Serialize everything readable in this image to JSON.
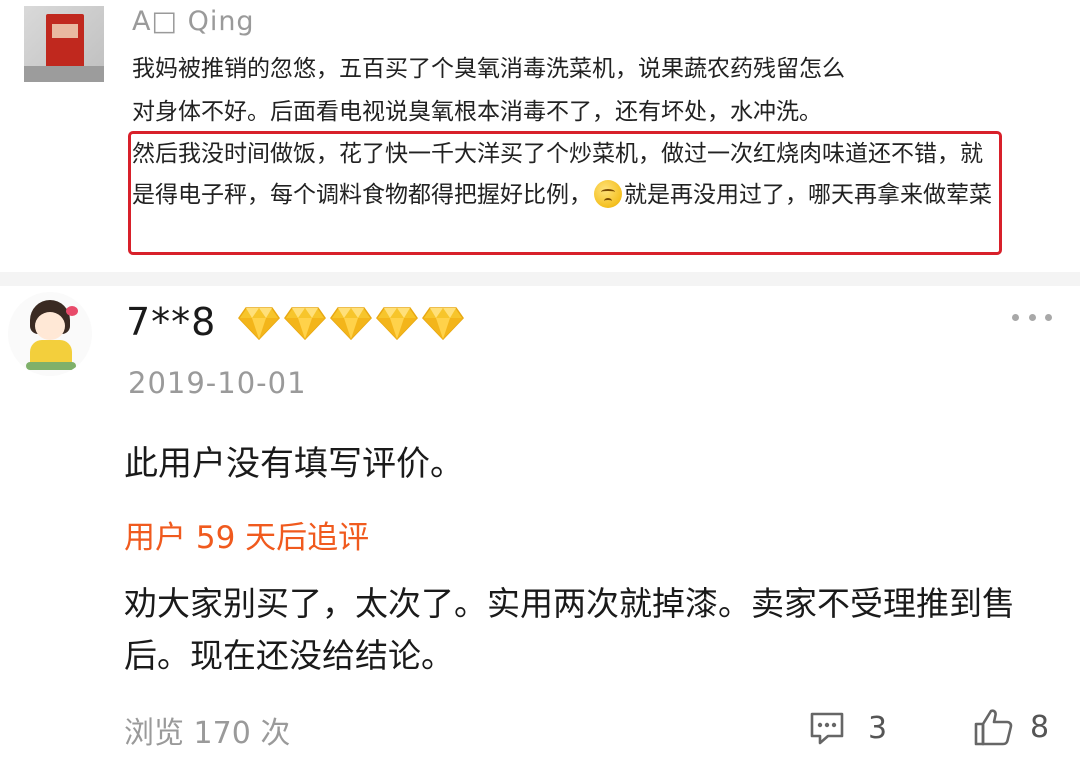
{
  "top_comment": {
    "username": "A□ Qing",
    "line1": "我妈被推销的忽悠，五百买了个臭氧消毒洗菜机，说果蔬农药残留怎么",
    "line2": "对身体不好。后面看电视说臭氧根本消毒不了，还有坏处，水冲洗。",
    "highlight_part1": "然后我没时间做饭，花了快一千大洋买了个炒菜机，做过一次红烧肉味道还不错，就是得电子秤，每个调料食物都得把握好比例，",
    "highlight_part2": "就是再没用过了，哪天再拿来做荤菜",
    "highlight_color": "#d8202a"
  },
  "review": {
    "username": "7**8",
    "diamond_count": 5,
    "date": "2019-10-01",
    "text": "此用户没有填写评价。",
    "followup_label": "用户 59 天后追评",
    "followup_text": "劝大家别买了，太次了。实用两次就掉漆。卖家不受理推到售后。现在还没给结论。",
    "followup_color": "#f05a1e"
  },
  "footer": {
    "views": "浏览 170 次",
    "comment_count": "3",
    "like_count": "8"
  },
  "icons": {
    "more": "more-dots-icon",
    "comment": "comment-bubble-icon",
    "like": "thumbs-up-icon",
    "level": "diamond-icon"
  }
}
